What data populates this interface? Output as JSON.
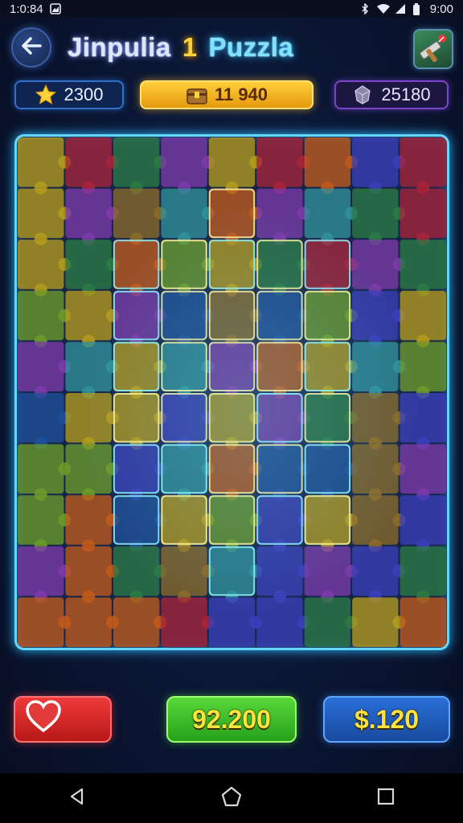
{
  "status_bar": {
    "time_left": "1:0:84",
    "time_right": "9:00"
  },
  "header": {
    "title_word1": "Jinpulia",
    "title_number": "1",
    "title_word2": "Puzzla"
  },
  "stats": {
    "stars": "2300",
    "coins": "11 940",
    "gems": "25180"
  },
  "buttons": {
    "score": "92.200",
    "cash": "$.120"
  },
  "colors": {
    "board_border": "#64d7ff",
    "pieces": [
      "#c05a1c",
      "#2b7a44",
      "#7b3aa8",
      "#1f4f9a",
      "#b39a1e",
      "#a8243a",
      "#2f8f9a",
      "#8a6a2a",
      "#3a3fb8",
      "#6a9a2a"
    ]
  },
  "icons": {
    "back": "arrow-left-icon",
    "tool": "hammer-icon",
    "stars": "star-icon",
    "coins": "chest-icon",
    "gems": "gem-icon",
    "lives": "heart-icon"
  }
}
